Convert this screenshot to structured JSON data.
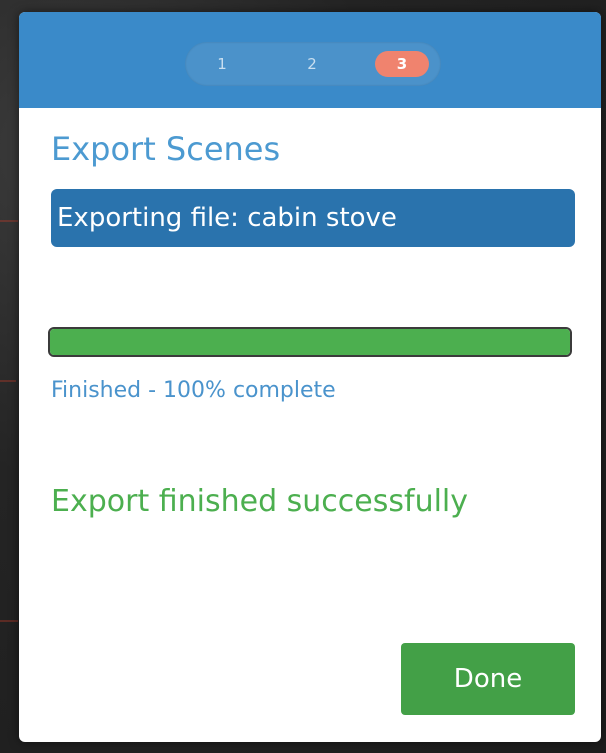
{
  "stepper": {
    "steps": [
      "1",
      "2",
      "3"
    ],
    "current_step": 3
  },
  "dialog": {
    "title": "Export Scenes",
    "file_status": "Exporting file: cabin stove",
    "progress": {
      "percent": 100,
      "status_text": "Finished - 100% complete"
    },
    "result_message": "Export finished successfully",
    "done_label": "Done"
  },
  "colors": {
    "header": "#3a8ac9",
    "accent_blue": "#4c9ad1",
    "file_box": "#2a73ad",
    "active_step": "#f0836e",
    "success_green": "#4caf4f",
    "button_green": "#43a047"
  }
}
